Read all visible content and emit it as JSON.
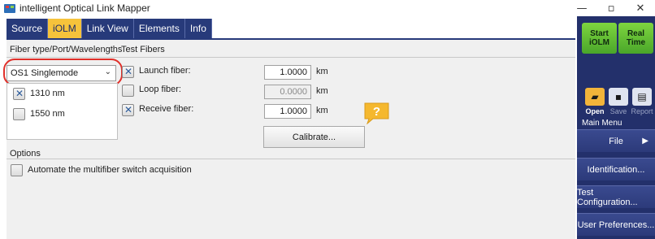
{
  "window": {
    "title": "intelligent Optical Link Mapper",
    "controls": {
      "minimize": "—",
      "maximize": "▫",
      "close": "✕"
    }
  },
  "tabs": [
    {
      "label": "Source",
      "active": false
    },
    {
      "label": "iOLM",
      "active": true
    },
    {
      "label": "Link View",
      "active": false
    },
    {
      "label": "Elements",
      "active": false
    },
    {
      "label": "Info",
      "active": false
    }
  ],
  "fiber": {
    "section_label": "Fiber type/Port/Wavelengths",
    "selected_type": "OS1 Singlemode",
    "wavelengths": [
      {
        "label": "1310 nm",
        "checked": true
      },
      {
        "label": "1550 nm",
        "checked": false
      }
    ]
  },
  "test_fibers": {
    "section_label": "Test Fibers",
    "launch": {
      "label": "Launch fiber:",
      "value": "1.0000",
      "unit": "km",
      "checked": true
    },
    "loop": {
      "label": "Loop fiber:",
      "value": "0.0000",
      "unit": "km",
      "checked": false
    },
    "receive": {
      "label": "Receive fiber:",
      "value": "1.0000",
      "unit": "km",
      "checked": true
    },
    "calibrate_label": "Calibrate...",
    "help_icon": "question-icon"
  },
  "options": {
    "section_label": "Options",
    "automate_label": "Automate the multifiber switch acquisition",
    "automate_checked": false
  },
  "sidebar": {
    "start_label": "Start iOLM",
    "realtime_label": "Real Time",
    "open_label": "Open",
    "save_label": "Save",
    "report_label": "Report",
    "menu_title": "Main Menu",
    "menu_items": [
      "File",
      "Identification...",
      "Test Configuration...",
      "User Preferences..."
    ]
  },
  "colors": {
    "accent_tab": "#f6c33b",
    "nav": "#273a7a",
    "start_green": "#5fbf32",
    "highlight": "#e0302a"
  }
}
